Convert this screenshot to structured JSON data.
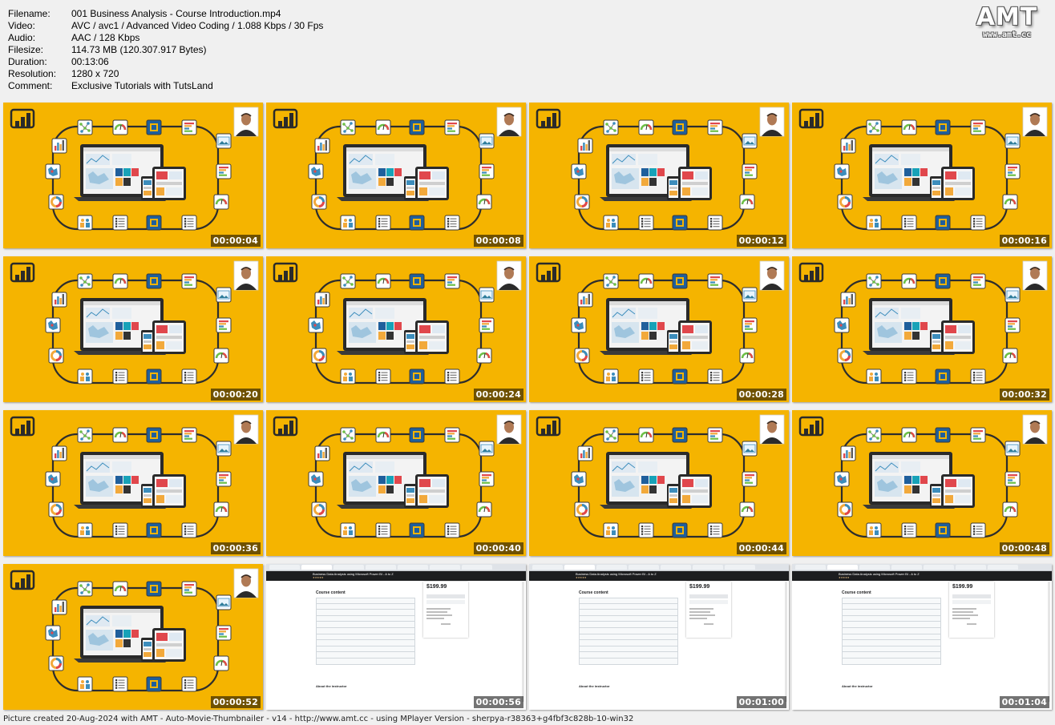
{
  "info": [
    {
      "key": "Filename:",
      "value": "001 Business Analysis - Course Introduction.mp4"
    },
    {
      "key": "Video:",
      "value": "AVC / avc1 / Advanced Video Coding / 1.088 Kbps / 30 Fps"
    },
    {
      "key": "Audio:",
      "value": "AAC / 128 Kbps"
    },
    {
      "key": "Filesize:",
      "value": "114.73 MB (120.307.917 Bytes)"
    },
    {
      "key": "Duration:",
      "value": "00:13:06"
    },
    {
      "key": "Resolution:",
      "value": "1280 x 720"
    },
    {
      "key": "Comment:",
      "value": "Exclusive Tutorials with TutsLand"
    }
  ],
  "logo": {
    "main": "AMT",
    "sub": "www.amt.cc"
  },
  "thumbnails": [
    {
      "time": "00:00:04",
      "kind": "diagram"
    },
    {
      "time": "00:00:08",
      "kind": "diagram"
    },
    {
      "time": "00:00:12",
      "kind": "diagram"
    },
    {
      "time": "00:00:16",
      "kind": "diagram"
    },
    {
      "time": "00:00:20",
      "kind": "diagram"
    },
    {
      "time": "00:00:24",
      "kind": "diagram"
    },
    {
      "time": "00:00:28",
      "kind": "diagram"
    },
    {
      "time": "00:00:32",
      "kind": "diagram"
    },
    {
      "time": "00:00:36",
      "kind": "diagram"
    },
    {
      "time": "00:00:40",
      "kind": "diagram"
    },
    {
      "time": "00:00:44",
      "kind": "diagram"
    },
    {
      "time": "00:00:48",
      "kind": "diagram"
    },
    {
      "time": "00:00:52",
      "kind": "diagram"
    },
    {
      "time": "00:00:56",
      "kind": "course"
    },
    {
      "time": "00:01:00",
      "kind": "course"
    },
    {
      "time": "00:01:04",
      "kind": "course"
    }
  ],
  "course_screen": {
    "header_title": "Business Data Analysis using Microsoft Power BI - A to Z",
    "section_title": "Course content",
    "price": "$199.99",
    "about": "About the instructor"
  },
  "footer": "Picture created 20-Aug-2024 with AMT - Auto-Movie-Thumbnailer - v14 - http://www.amt.cc - using MPlayer Version - sherpya-r38363+g4fbf3c828b-10-win32",
  "colors": {
    "thumb_background": "#f5b400",
    "powerbi_dark": "#2a2a2a",
    "ring_dark": "#2d2d2d"
  }
}
